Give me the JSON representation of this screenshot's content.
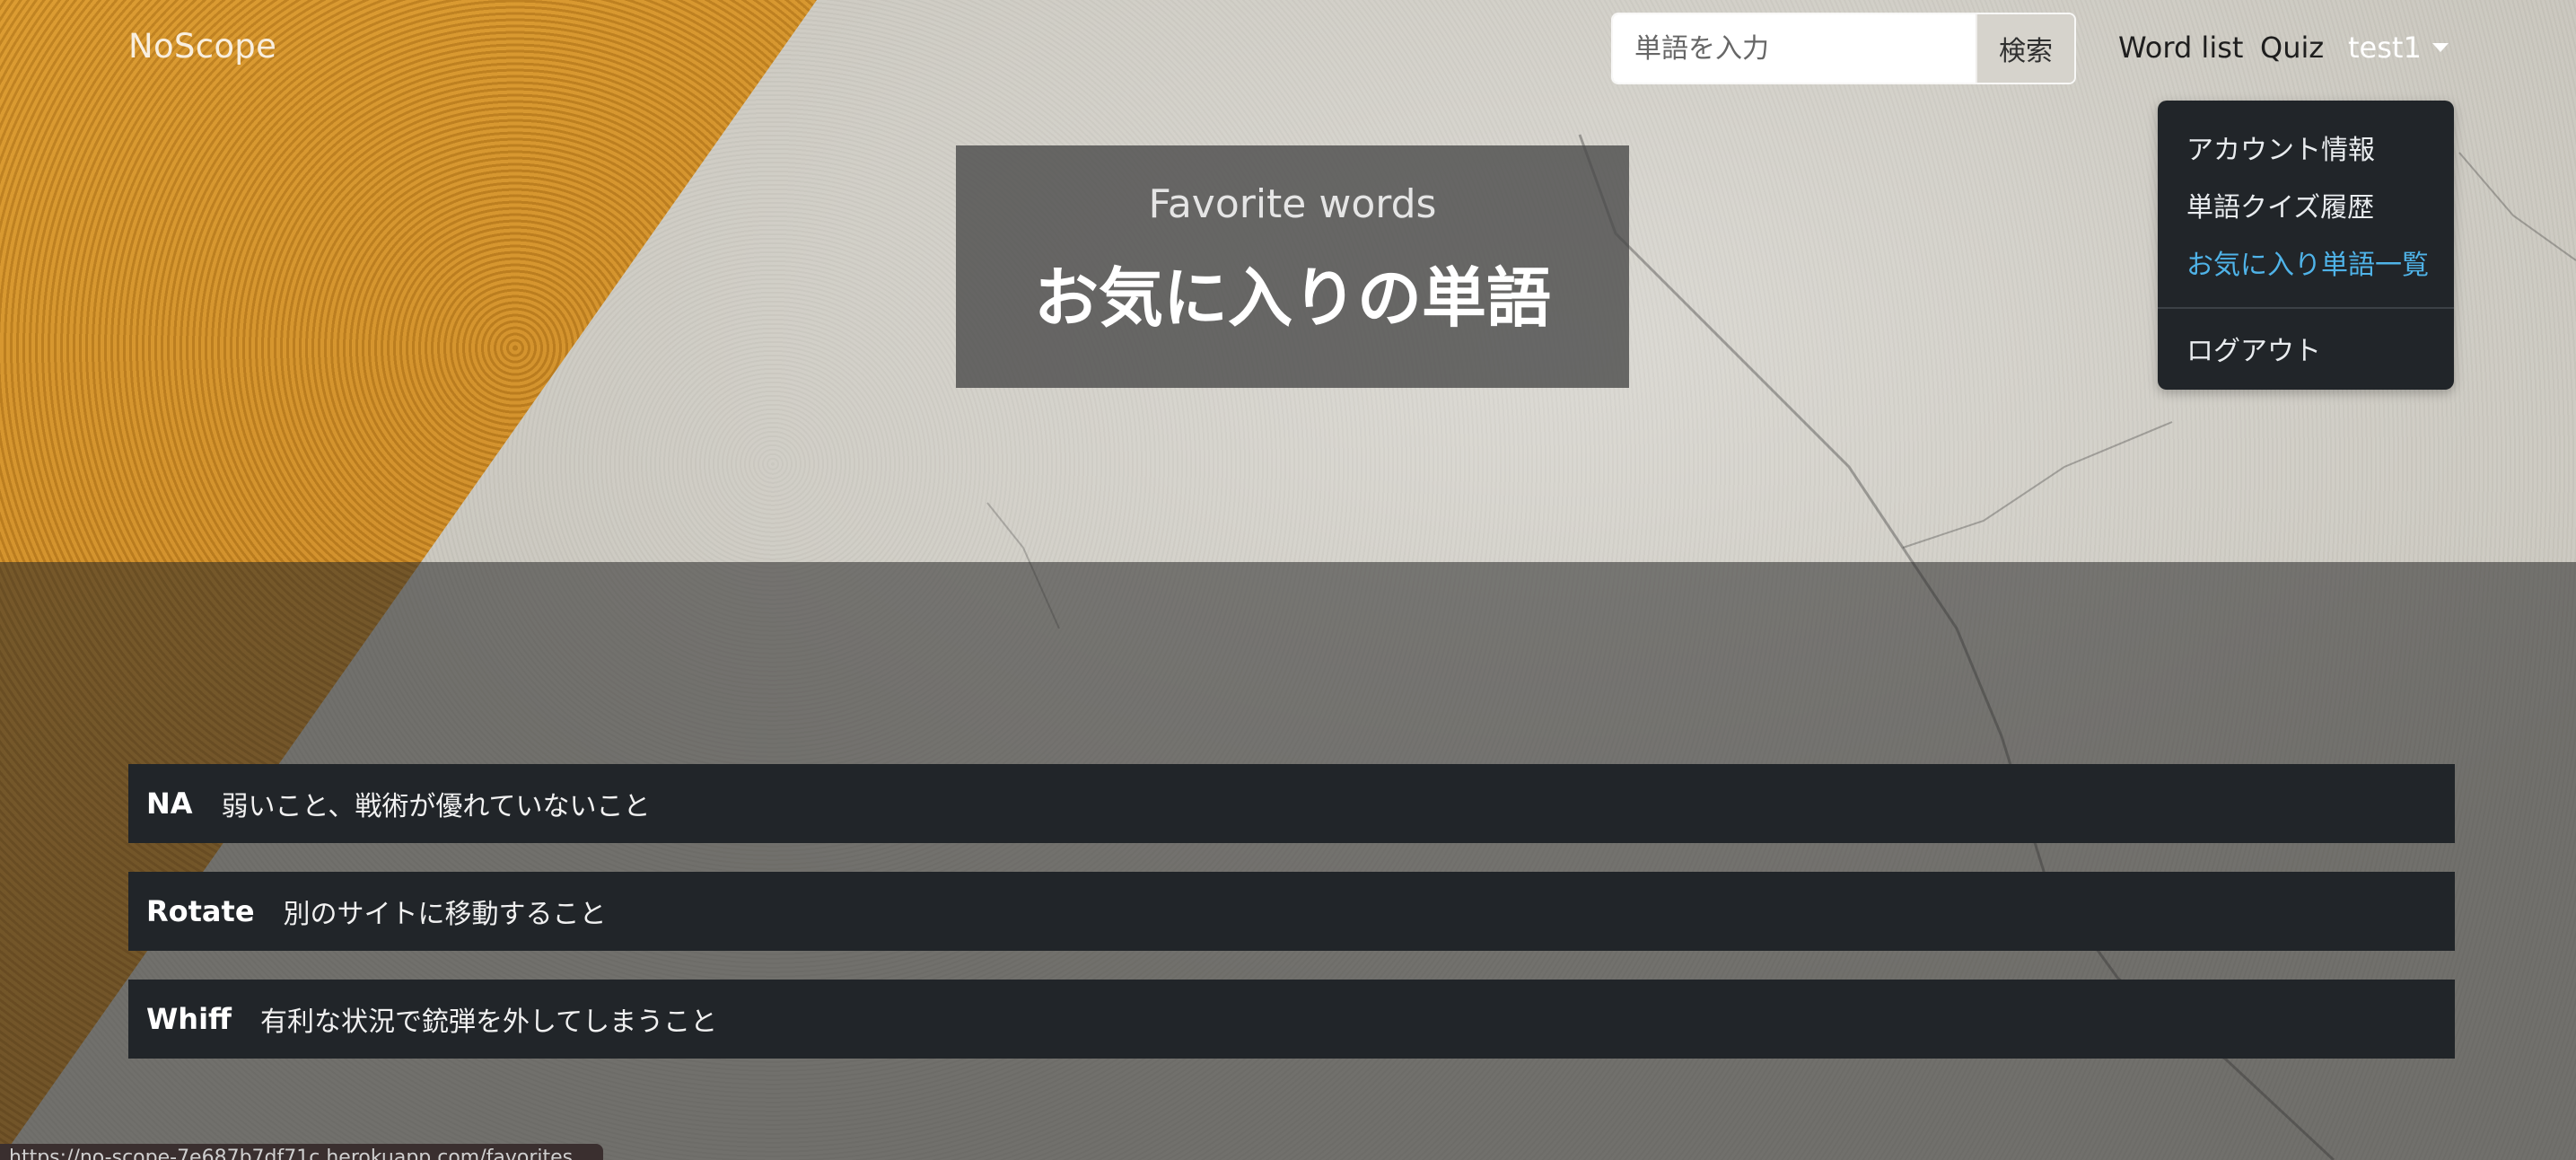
{
  "nav": {
    "brand": "NoScope",
    "search": {
      "placeholder": "単語を入力",
      "button_label": "検索"
    },
    "links": [
      {
        "label": "Word list"
      },
      {
        "label": "Quiz"
      }
    ],
    "user": "test1"
  },
  "dropdown": {
    "items": [
      {
        "label": "アカウント情報",
        "active": false
      },
      {
        "label": "単語クイズ履歴",
        "active": false
      },
      {
        "label": "お気に入り単語一覧",
        "active": true
      }
    ],
    "logout_label": "ログアウト"
  },
  "hero": {
    "subtitle": "Favorite words",
    "title": "お気に入りの単語"
  },
  "words": [
    {
      "term": "NA",
      "definition": "弱いこと、戦術が優れていないこと"
    },
    {
      "term": "Rotate",
      "definition": "別のサイトに移動すること"
    },
    {
      "term": "Whiff",
      "definition": "有利な状況で銃弾を外してしまうこと"
    }
  ],
  "status_url": "https://no-scope-7e687b7df71c.herokuapp.com/favorites",
  "colors": {
    "dark": "#212529",
    "active_link": "#4fb3e8",
    "orange_wall": "#c8841f"
  }
}
